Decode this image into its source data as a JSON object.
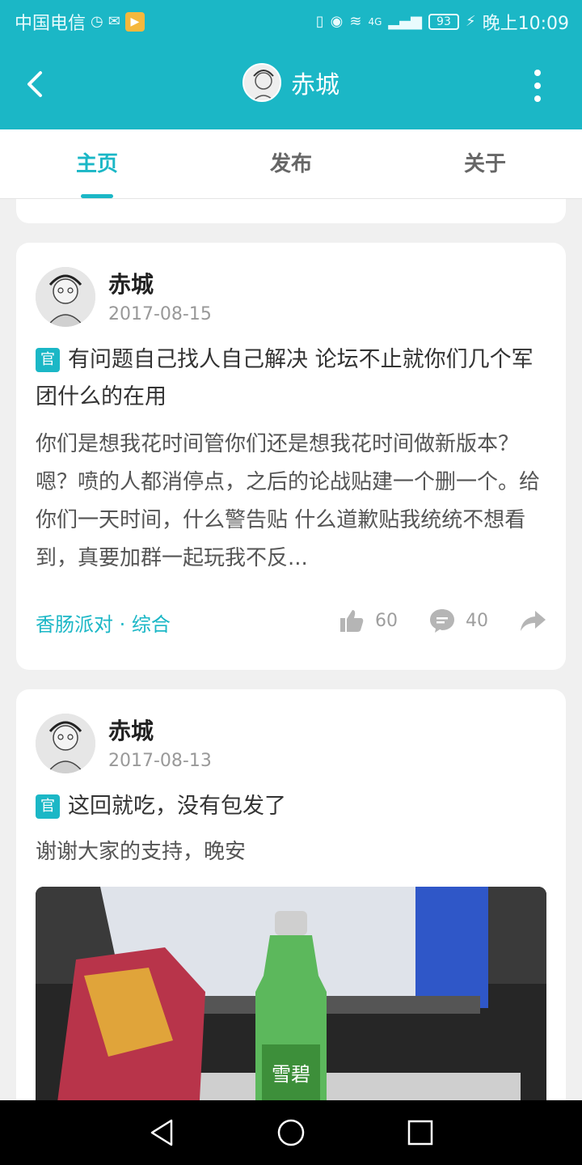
{
  "status_bar": {
    "carrier": "中国电信",
    "network": "4G",
    "battery": "93",
    "time": "晚上10:09"
  },
  "header": {
    "title": "赤城"
  },
  "tabs": [
    {
      "label": "主页",
      "active": true
    },
    {
      "label": "发布",
      "active": false
    },
    {
      "label": "关于",
      "active": false
    }
  ],
  "posts": [
    {
      "author": "赤城",
      "date": "2017-08-15",
      "badge": "官",
      "title": "有问题自己找人自己解决 论坛不止就你们几个军团什么的在用",
      "body": "你们是想我花时间管你们还是想我花时间做新版本？嗯？喷的人都消停点，之后的论战贴建一个删一个。给你们一天时间，什么警告贴 什么道歉贴我统统不想看到，真要加群一起玩我不反...",
      "tags": "香肠派对 · 综合",
      "likes": "60",
      "comments": "40"
    },
    {
      "author": "赤城",
      "date": "2017-08-13",
      "badge": "官",
      "title": "这回就吃，没有包发了",
      "body": "谢谢大家的支持，晚安",
      "photo_text": "雪碧"
    }
  ],
  "colors": {
    "accent": "#1bb7c6",
    "background": "#f0f0f0"
  }
}
